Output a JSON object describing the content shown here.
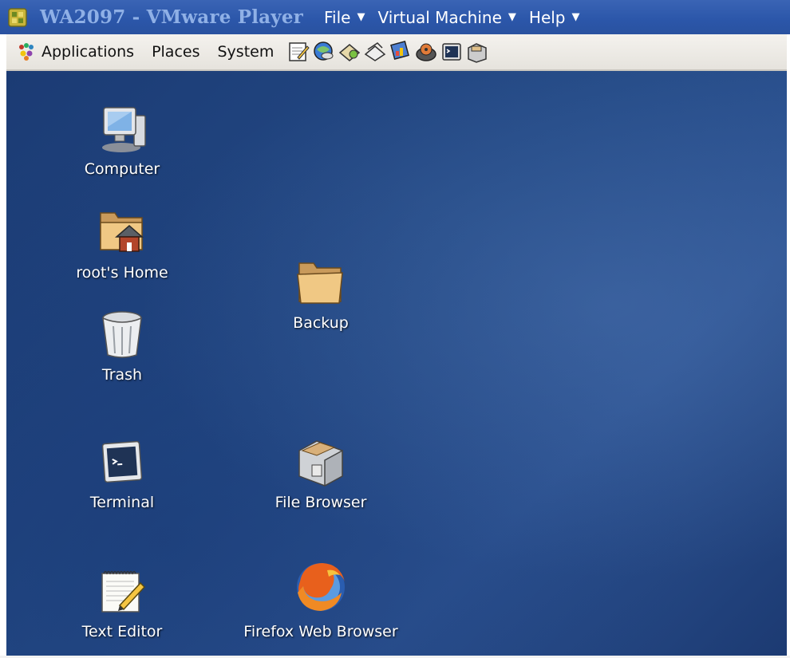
{
  "window": {
    "title": "WA2097 - VMware Player",
    "menus": [
      {
        "label": "File"
      },
      {
        "label": "Virtual Machine"
      },
      {
        "label": "Help"
      }
    ],
    "caret": "▼"
  },
  "panel": {
    "menus": [
      "Applications",
      "Places",
      "System"
    ],
    "launchers": [
      "text-editor-icon",
      "network-icon",
      "mail-icon",
      "messenger-icon",
      "presentation-icon",
      "media-player-icon",
      "terminal-icon",
      "file-browser-icon"
    ]
  },
  "desktop": {
    "icons": [
      {
        "label": "Computer",
        "icon": "computer-icon"
      },
      {
        "label": "root's Home",
        "icon": "home-folder-icon"
      },
      {
        "label": "Trash",
        "icon": "trash-icon"
      },
      {
        "label": "Backup",
        "icon": "folder-icon"
      },
      {
        "label": "Terminal",
        "icon": "terminal-icon"
      },
      {
        "label": "File Browser",
        "icon": "file-browser-icon"
      },
      {
        "label": "Text Editor",
        "icon": "text-editor-icon"
      },
      {
        "label": "Firefox Web Browser",
        "icon": "firefox-icon"
      }
    ]
  },
  "colors": {
    "titlebar": "#2b56a9",
    "title_text": "#8fb0e6",
    "desktop": "#244a86",
    "panel": "#ece9e4"
  }
}
